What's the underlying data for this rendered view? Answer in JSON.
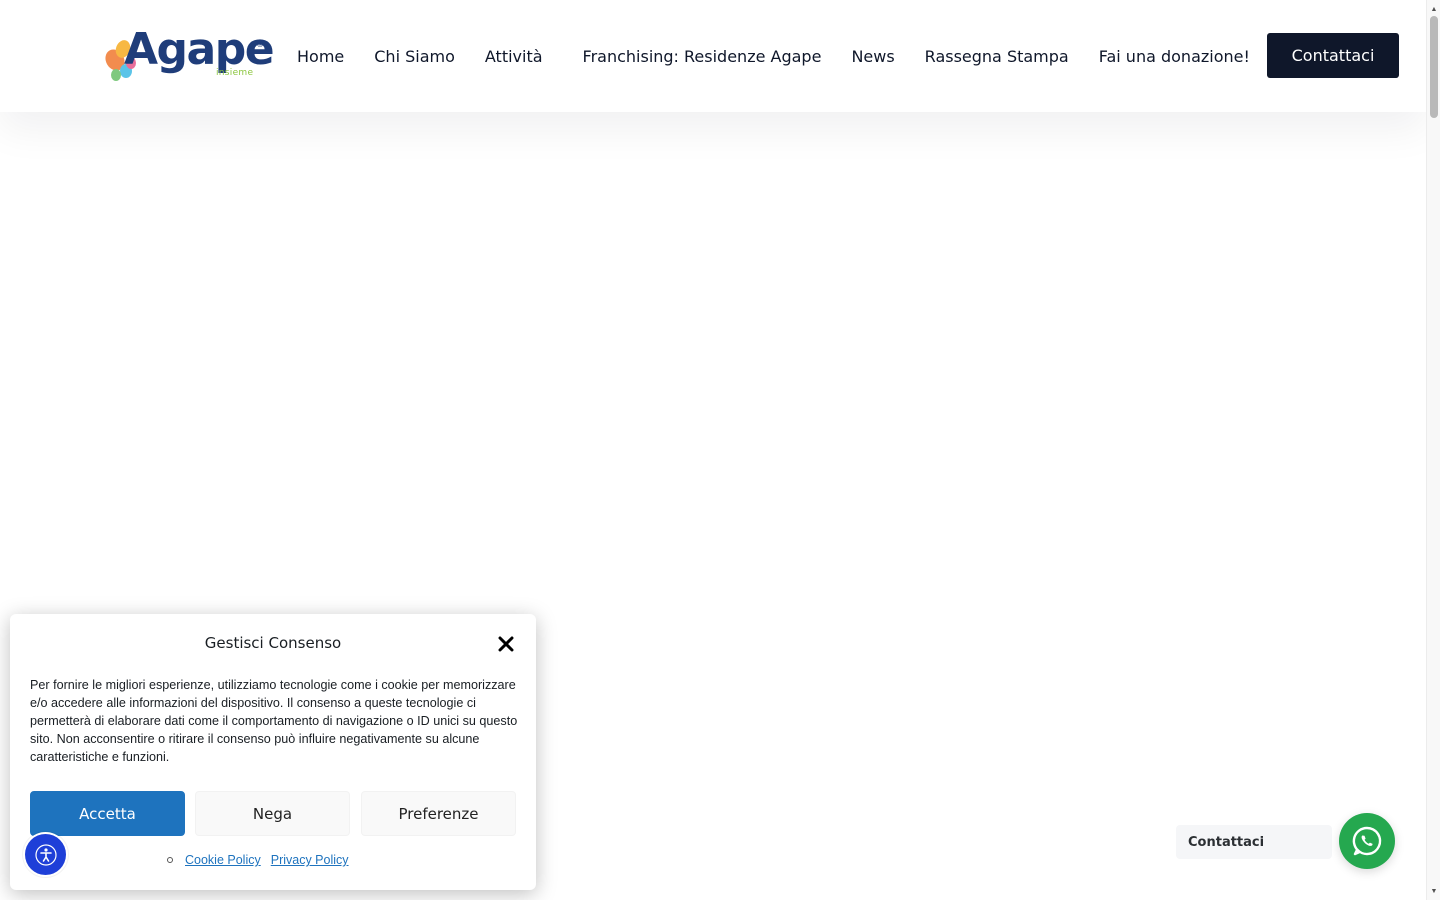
{
  "header": {
    "logo": {
      "word": "Agape",
      "registered_mark": "®",
      "tagline": "insieme"
    },
    "nav": [
      {
        "label": "Home"
      },
      {
        "label": "Chi Siamo"
      },
      {
        "label": "Attività"
      },
      {
        "label": "Franchising: Residenze Agape"
      },
      {
        "label": "News"
      },
      {
        "label": "Rassegna Stampa"
      },
      {
        "label": "Fai una donazione!"
      }
    ],
    "cta_label": "Contattaci"
  },
  "consent": {
    "title": "Gestisci Consenso",
    "body": "Per fornire le migliori esperienze, utilizziamo tecnologie come i cookie per memorizzare e/o accedere alle informazioni del dispositivo. Il consenso a queste tecnologie ci permetterà di elaborare dati come il comportamento di navigazione o ID unici su questo sito. Non acconsentire o ritirare il consenso può influire negativamente su alcune caratteristiche e funzioni.",
    "accept_label": "Accetta",
    "deny_label": "Nega",
    "preferences_label": "Preferenze",
    "links": [
      {
        "label": "Cookie Policy"
      },
      {
        "label": "Privacy Policy"
      }
    ],
    "close_icon": "close-icon"
  },
  "accessibility_button": {
    "icon": "accessibility-icon"
  },
  "whatsapp": {
    "label": "Contattaci",
    "icon": "whatsapp-icon"
  },
  "colors": {
    "brand_navy": "#1f3d7a",
    "cta_bg": "#0f172a",
    "accept_blue": "#1e73be",
    "whatsapp_green": "#25a84f",
    "a11y_blue": "#1e3fd8"
  }
}
